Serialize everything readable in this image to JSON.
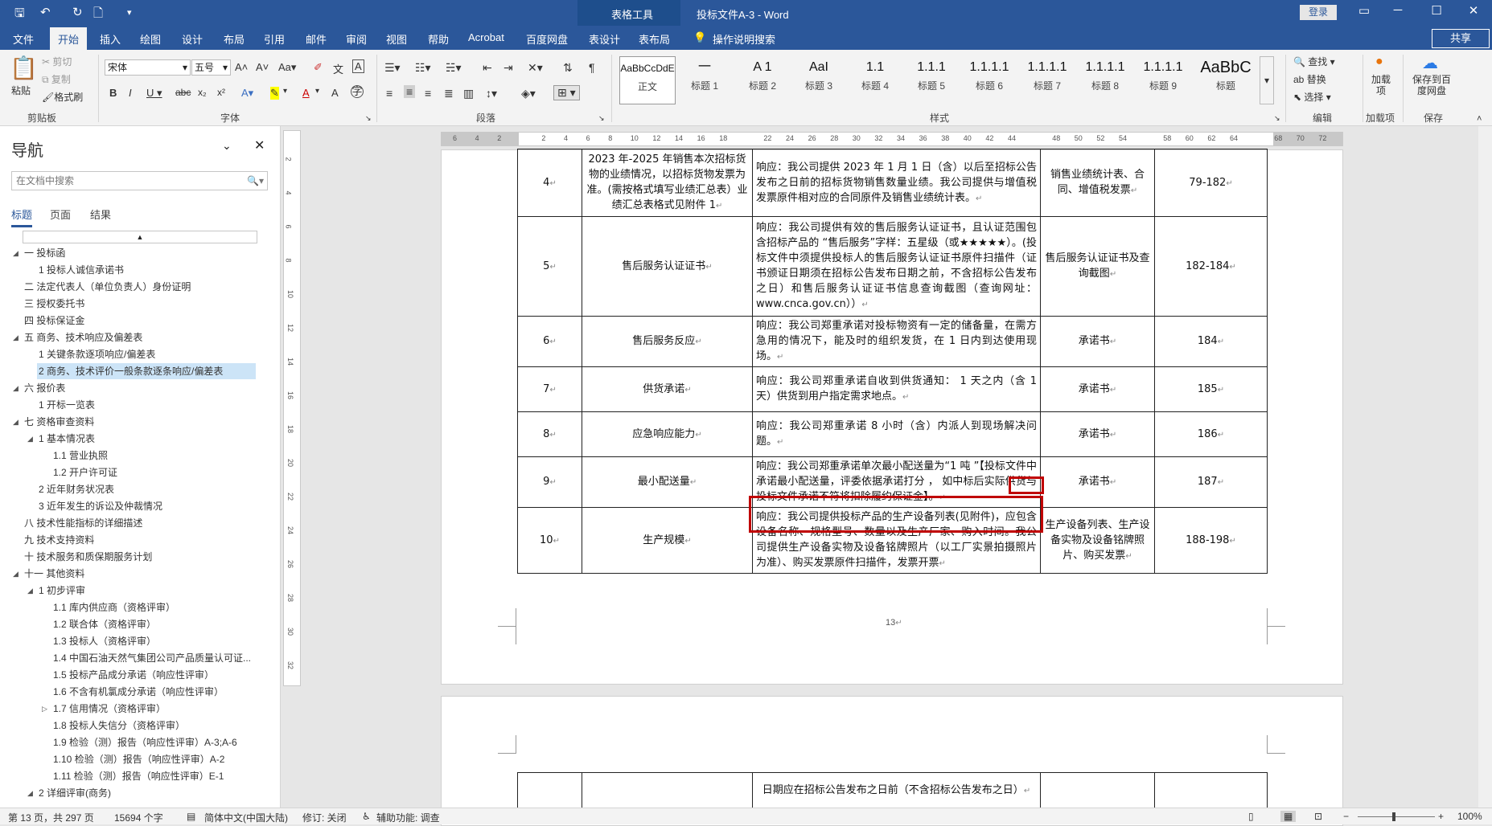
{
  "titlebar": {
    "context_tab": "表格工具",
    "doc_title": "投标文件A-3  -  Word",
    "login": "登录",
    "window_controls": [
      "restore-ribbon-icon",
      "minimize-icon",
      "maximize-icon",
      "close-icon"
    ]
  },
  "tabs": [
    "文件",
    "开始",
    "插入",
    "绘图",
    "设计",
    "布局",
    "引用",
    "邮件",
    "审阅",
    "视图",
    "帮助",
    "Acrobat",
    "百度网盘",
    "表设计",
    "表布局"
  ],
  "tell_me": "操作说明搜索",
  "share": "共享",
  "ribbon": {
    "clipboard": {
      "paste": "粘贴",
      "cut": "剪切",
      "copy": "复制",
      "format_painter": "格式刷",
      "label": "剪贴板"
    },
    "font": {
      "name": "宋体",
      "size": "五号",
      "label": "字体"
    },
    "paragraph": {
      "label": "段落"
    },
    "styles": {
      "label": "样式",
      "items": [
        {
          "preview": "AaBbCcDdE",
          "name": "正文"
        },
        {
          "preview": "一",
          "name": "标题 1"
        },
        {
          "preview": "A 1",
          "name": "标题 2"
        },
        {
          "preview": "AaI",
          "name": "标题 3"
        },
        {
          "preview": "1.1",
          "name": "标题 4"
        },
        {
          "preview": "1.1.1",
          "name": "标题 5"
        },
        {
          "preview": "1.1.1.1",
          "name": "标题 6"
        },
        {
          "preview": "1.1.1.1",
          "name": "标题 7"
        },
        {
          "preview": "1.1.1.1",
          "name": "标题 8"
        },
        {
          "preview": "1.1.1.1",
          "name": "标题 9"
        },
        {
          "preview": "1.1.1.1",
          "name": "标题 9"
        },
        {
          "preview": "AaBbC",
          "name": "标题"
        }
      ]
    },
    "editing": {
      "find": "查找",
      "replace": "替换",
      "select": "选择",
      "label": "编辑"
    },
    "addins": {
      "load": "加载项",
      "label": "加载项"
    },
    "save": {
      "save_baidu": "保存到百度网盘",
      "label": "保存"
    }
  },
  "nav": {
    "title": "导航",
    "search_placeholder": "在文档中搜索",
    "tabs": [
      "标题",
      "页面",
      "结果"
    ],
    "items": [
      {
        "text": "一 投标函",
        "level": 0,
        "expanded": true
      },
      {
        "text": "1 投标人诚信承诺书",
        "level": 1
      },
      {
        "text": "二 法定代表人（单位负责人）身份证明",
        "level": 0
      },
      {
        "text": "三 授权委托书",
        "level": 0
      },
      {
        "text": "四 投标保证金",
        "level": 0
      },
      {
        "text": "五 商务、技术响应及偏差表",
        "level": 0,
        "expanded": true
      },
      {
        "text": "1 关键条款逐项响应/偏差表",
        "level": 1
      },
      {
        "text": "2 商务、技术评价一般条款逐条响应/偏差表",
        "level": 1,
        "selected": true
      },
      {
        "text": "六 报价表",
        "level": 0,
        "expanded": true
      },
      {
        "text": "1 开标一览表",
        "level": 1
      },
      {
        "text": "七 资格审查资料",
        "level": 0,
        "expanded": true
      },
      {
        "text": "1 基本情况表",
        "level": 1,
        "expanded": true
      },
      {
        "text": "1.1 营业执照",
        "level": 2
      },
      {
        "text": "1.2 开户许可证",
        "level": 2
      },
      {
        "text": "2 近年财务状况表",
        "level": 1
      },
      {
        "text": "3 近年发生的诉讼及仲裁情况",
        "level": 1
      },
      {
        "text": "八 技术性能指标的详细描述",
        "level": 0
      },
      {
        "text": "九 技术支持资料",
        "level": 0
      },
      {
        "text": "十 技术服务和质保期服务计划",
        "level": 0
      },
      {
        "text": "十一 其他资料",
        "level": 0,
        "expanded": true
      },
      {
        "text": "1 初步评审",
        "level": 1,
        "expanded": true
      },
      {
        "text": "1.1 库内供应商（资格评审）",
        "level": 2
      },
      {
        "text": "1.2 联合体（资格评审）",
        "level": 2
      },
      {
        "text": "1.3 投标人（资格评审）",
        "level": 2
      },
      {
        "text": "1.4 中国石油天然气集团公司产品质量认可证...",
        "level": 2
      },
      {
        "text": "1.5 投标产品成分承诺（响应性评审）",
        "level": 2
      },
      {
        "text": "1.6 不含有机氯成分承诺（响应性评审）",
        "level": 2
      },
      {
        "text": "1.7 信用情况（资格评审）",
        "level": 2,
        "collapsed": true
      },
      {
        "text": "1.8 投标人失信分（资格评审）",
        "level": 2
      },
      {
        "text": "1.9 检验（测）报告（响应性评审）A-3;A-6",
        "level": 2
      },
      {
        "text": "1.10 检验（测）报告（响应性评审）A-2",
        "level": 2
      },
      {
        "text": "1.11 检验（测）报告（响应性评审）E-1",
        "level": 2
      },
      {
        "text": "2 详细评审(商务)",
        "level": 1,
        "expanded": true
      }
    ]
  },
  "ruler": {
    "h_ticks": [
      "6",
      "4",
      "2",
      "",
      "2",
      "4",
      "6",
      "8",
      "10",
      "12",
      "14",
      "16",
      "18",
      "",
      "22",
      "24",
      "26",
      "28",
      "30",
      "32",
      "34",
      "36",
      "38",
      "40",
      "42",
      "44",
      "",
      "48",
      "50",
      "52",
      "54",
      "",
      "58",
      "60",
      "62",
      "64",
      "",
      "68",
      "70",
      "72"
    ],
    "v_ticks": [
      "2",
      "4",
      "6",
      "8",
      "10",
      "12",
      "14",
      "16",
      "18",
      "20",
      "22",
      "24",
      "26",
      "28",
      "30",
      "32"
    ]
  },
  "table": {
    "rows": [
      {
        "no": "4",
        "item": "2023 年-2025 年销售本次招标货物的业绩情况，以招标货物发票为准。(需按格式填写业绩汇总表）业绩汇总表格式见附件 1",
        "response": "响应：我公司提供 2023 年 1 月 1 日（含）以后至招标公告发布之日前的招标货物销售数量业绩。我公司提供与增值税发票原件相对应的合同原件及销售业绩统计表。",
        "evidence": "销售业绩统计表、合同、增值税发票",
        "page": "79-182"
      },
      {
        "no": "5",
        "item": "售后服务认证证书",
        "response": "响应：我公司提供有效的售后服务认证证书，且认证范围包含招标产品的 “售后服务”字样：五星级（或★★★★★）。(投标文件中须提供投标人的售后服务认证证书原件扫描件（证书颁证日期须在招标公告发布日期之前，不含招标公告发布之日）和售后服务认证证书信息查询截图（查询网址：www.cnca.gov.cn））",
        "evidence": "售后服务认证证书及查询截图",
        "page": "182-184"
      },
      {
        "no": "6",
        "item": "售后服务反应",
        "response": "响应：我公司郑重承诺对投标物资有一定的储备量，在需方急用的情况下，能及时的组织发货，在 1 日内到达使用现场。",
        "evidence": "承诺书",
        "page": "184"
      },
      {
        "no": "7",
        "item": "供货承诺",
        "response": "响应：我公司郑重承诺自收到供货通知： 1 天之内（含 1 天）供货到用户指定需求地点。",
        "evidence": "承诺书",
        "page": "185"
      },
      {
        "no": "8",
        "item": "应急响应能力",
        "response": "响应：我公司郑重承诺 8 小时（含）内派人到现场解决问题。",
        "evidence": "承诺书",
        "page": "186"
      },
      {
        "no": "9",
        "item": "最小配送量",
        "response": "响应：我公司郑重承诺单次最小配送量为“1 吨 ”【投标文件中承诺最小配送量，评委依据承诺打分 ， 如中标后实际供货与投标文件承诺不符将扣除履约保证金】。",
        "evidence": "承诺书",
        "page": "187"
      },
      {
        "no": "10",
        "item": "生产规模",
        "response": "响应：我公司提供投标产品的生产设备列表(见附件)，应包含设备名称、规格型号、数量以及生产厂家、购入时间。我公司提供生产设备实物及设备铭牌照片（以工厂实景拍摄照片为准）、购买发票原件扫描件，发票开票",
        "evidence": "生产设备列表、生产设备实物及设备铭牌照片、购买发票",
        "page": "188-198"
      }
    ],
    "page2_row": {
      "response": "日期应在招标公告发布之日前（不含招标公告发布之日）"
    }
  },
  "page_number": "13",
  "status": {
    "page": "第 13 页，共 297 页",
    "words": "15694 个字",
    "lang": "简体中文(中国大陆)",
    "track": "修订: 关闭",
    "access": "辅助功能: 调查",
    "zoom": "100%"
  }
}
